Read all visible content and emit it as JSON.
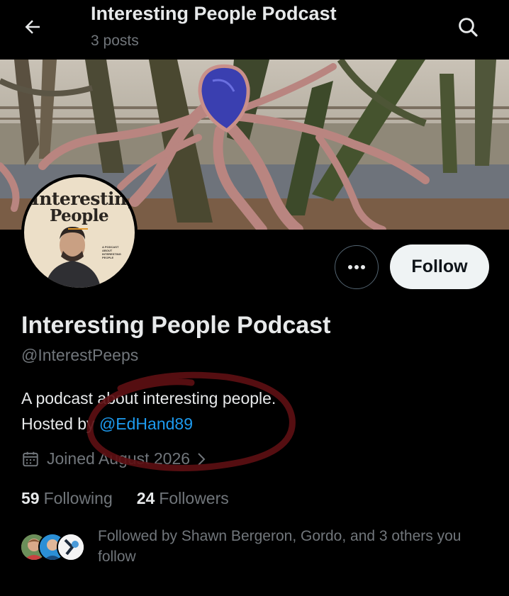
{
  "header": {
    "title": "Interesting People Podcast",
    "subtitle": "3 posts"
  },
  "avatar": {
    "line1": "Interesting",
    "line2": "People",
    "tagline": "A PODCAST ABOUT INTERESTING PEOPLE"
  },
  "actions": {
    "follow_label": "Follow"
  },
  "profile": {
    "display_name": "Interesting People Podcast",
    "handle": "@InterestPeeps",
    "bio_line1": "A podcast about interesting people.",
    "bio_line2_prefix": "Hosted by ",
    "bio_mention": "@EdHand89",
    "joined": "Joined August 2026"
  },
  "stats": {
    "following_count": "59",
    "following_label": "Following",
    "followers_count": "24",
    "followers_label": "Followers"
  },
  "followed_by": {
    "text": "Followed by Shawn Bergeron, Gordo, and 3 others you follow"
  },
  "colors": {
    "background": "#000000",
    "text_primary": "#e7e9ea",
    "text_secondary": "#71767b",
    "link": "#1d9bf0",
    "follow_button_bg": "#eff3f4",
    "annotation": "#5c0f12"
  },
  "icons": [
    "back-arrow-icon",
    "search-icon",
    "more-dots-icon",
    "calendar-icon",
    "chevron-right-icon"
  ]
}
